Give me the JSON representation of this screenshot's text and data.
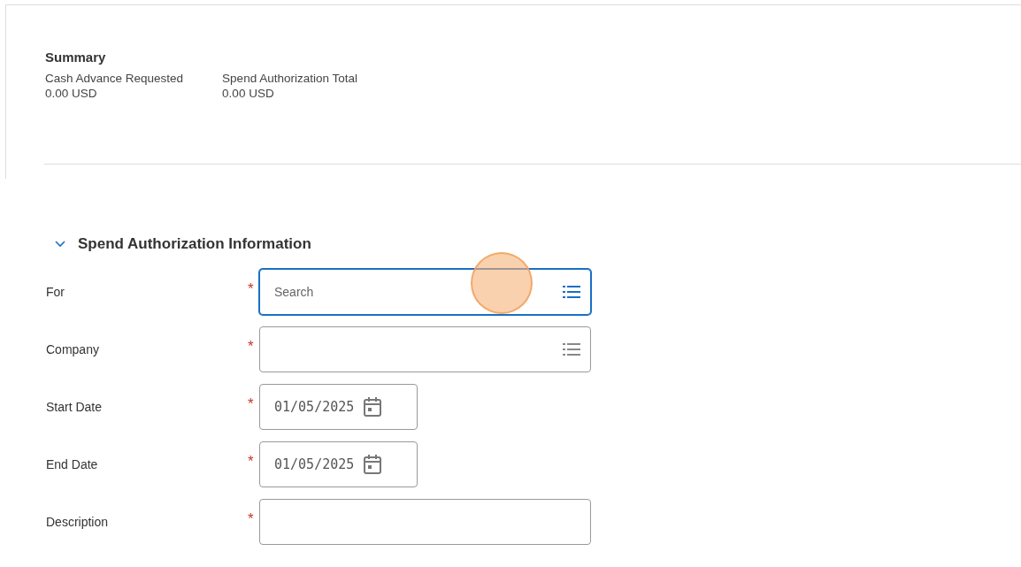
{
  "summary": {
    "title": "Summary",
    "items": [
      {
        "label": "Cash Advance Requested",
        "value": "0.00 USD"
      },
      {
        "label": "Spend Authorization Total",
        "value": "0.00 USD"
      }
    ]
  },
  "section": {
    "title": "Spend Authorization Information",
    "expanded": true,
    "fields": [
      {
        "kind": "prompt",
        "label": "For",
        "required_mark": "*",
        "placeholder": "Search",
        "focused": true
      },
      {
        "kind": "prompt",
        "label": "Company",
        "required_mark": "*",
        "focused": false
      },
      {
        "kind": "date",
        "label": "Start Date",
        "required_mark": "*",
        "value": "01/05/2025",
        "focused": false
      },
      {
        "kind": "date",
        "label": "End Date",
        "required_mark": "*",
        "value": "01/05/2025",
        "focused": false
      },
      {
        "kind": "text",
        "label": "Description",
        "required_mark": "*",
        "focused": false
      }
    ]
  }
}
